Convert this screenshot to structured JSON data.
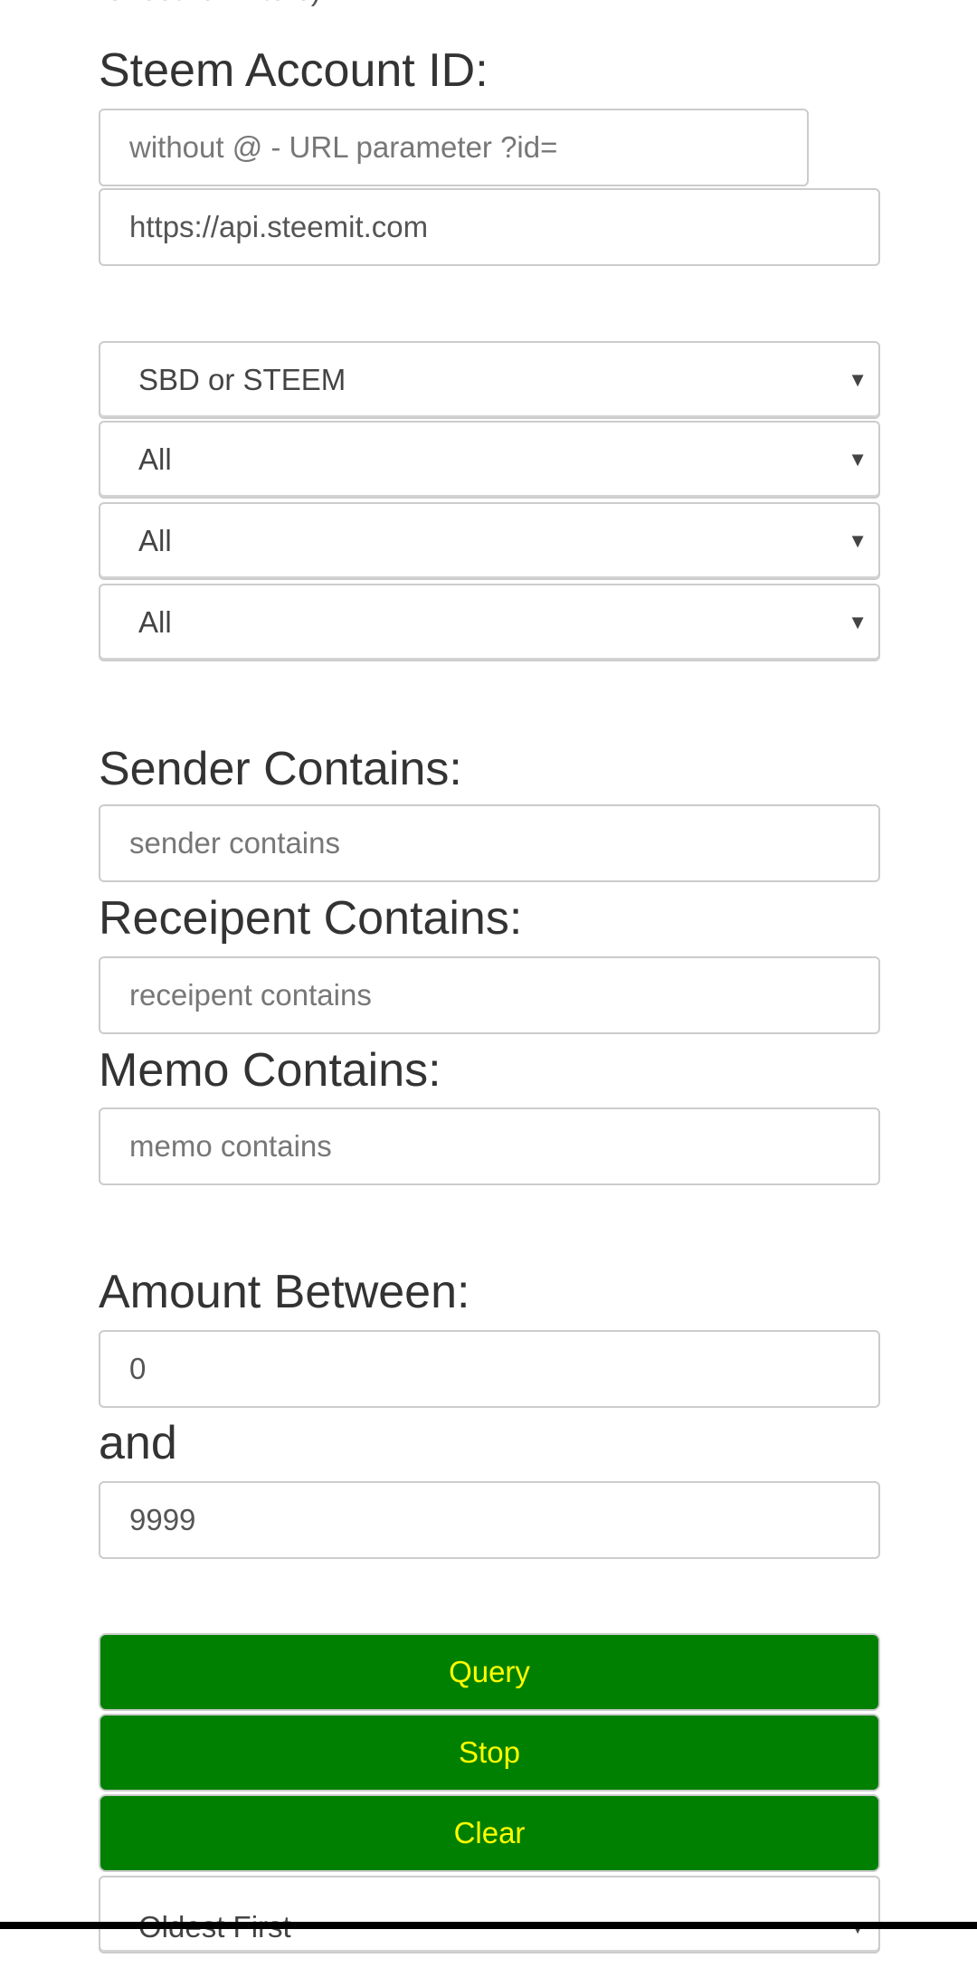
{
  "top_text": "for search filters).",
  "account": {
    "label": "Steem Account ID:",
    "id_placeholder": "without @ - URL parameter ?id=",
    "api_value": "https://api.steemit.com"
  },
  "selects": [
    "SBD or STEEM",
    "All",
    "All",
    "All"
  ],
  "sender": {
    "label": "Sender Contains:",
    "placeholder": "sender contains"
  },
  "recipient": {
    "label": "Receipent Contains:",
    "placeholder": "receipent contains"
  },
  "memo": {
    "label": "Memo Contains:",
    "placeholder": "memo contains"
  },
  "amount": {
    "label": "Amount Between:",
    "min": "0",
    "and_label": "and",
    "max": "9999"
  },
  "buttons": {
    "query": "Query",
    "stop": "Stop",
    "clear": "Clear"
  },
  "sort": {
    "value": "Oldest First"
  },
  "arrow": "▼",
  "colors": {
    "button_bg": "#008000",
    "button_text": "#ffff00"
  }
}
